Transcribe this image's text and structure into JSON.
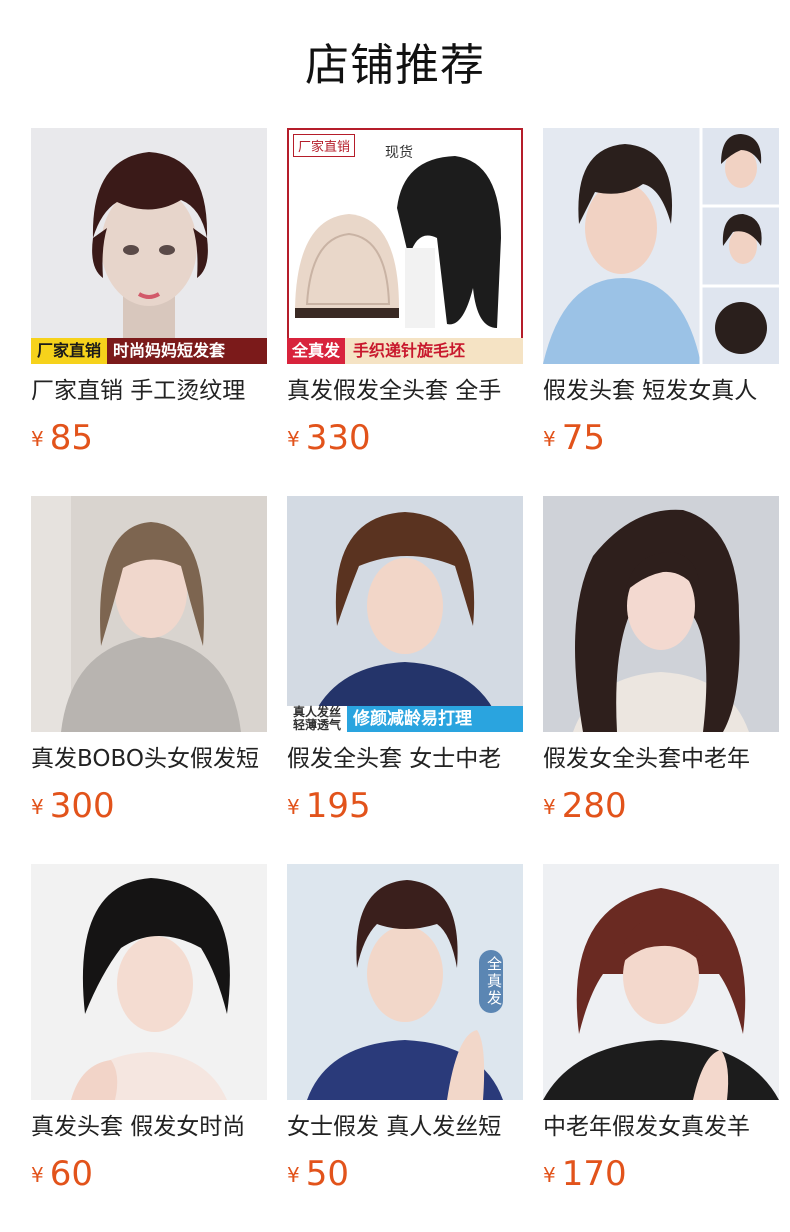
{
  "section": {
    "title": "店铺推荐"
  },
  "currency": "¥",
  "products": [
    {
      "name": "厂家直销 手工烫纹理",
      "price": "85",
      "banner_left": "厂家直销",
      "banner_right": "时尚妈妈短发套",
      "hair_color": "#3a1a18",
      "bg": "#e9e9ec"
    },
    {
      "name": "真发假发全头套 全手",
      "price": "330",
      "tag_left": "厂家直销",
      "tag_right": "现货",
      "banner_left": "全真发",
      "banner_right": "手织递针旋毛坯",
      "hair_color": "#1c1c1c",
      "bg": "#ffffff"
    },
    {
      "name": "假发头套 短发女真人",
      "price": "75",
      "hair_color": "#2a1f1c",
      "bg": "#dfe5ef"
    },
    {
      "name": "真发BOBO头女假发短",
      "price": "300",
      "hair_color": "#7d6550",
      "bg": "#d9d4cf"
    },
    {
      "name": "假发全头套 女士中老",
      "price": "195",
      "banner_left_line1": "真人发丝",
      "banner_left_line2": "轻薄透气",
      "banner_right": "修颜减龄易打理",
      "hair_color": "#5a3320",
      "bg": "#d3dae3"
    },
    {
      "name": "假发女全头套中老年",
      "price": "280",
      "hair_color": "#2e1f1c",
      "bg": "#cfd2d8"
    },
    {
      "name": "真发头套 假发女时尚",
      "price": "60",
      "hair_color": "#151414",
      "bg": "#f2f2f2"
    },
    {
      "name": "女士假发 真人发丝短",
      "price": "50",
      "vertical_tag": "全真发",
      "hair_color": "#3a1f1c",
      "bg": "#dde6ee"
    },
    {
      "name": "中老年假发女真发羊",
      "price": "170",
      "hair_color": "#6a2a22",
      "bg": "#eef0f3"
    }
  ]
}
